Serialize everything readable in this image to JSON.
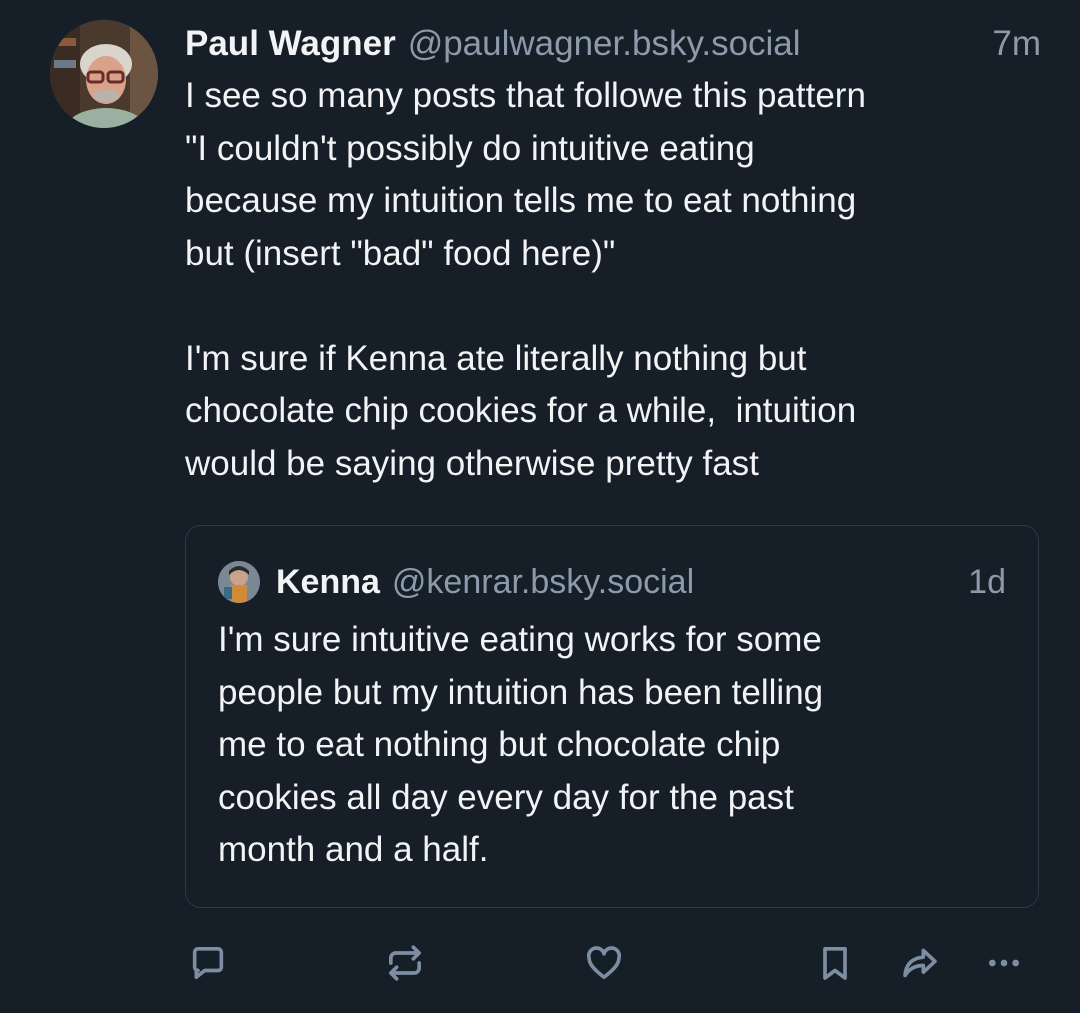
{
  "post": {
    "author": {
      "name": "Paul Wagner",
      "handle": "@paulwagner.bsky.social",
      "avatar_icon": "user-avatar-photo"
    },
    "timestamp": "7m",
    "text": "I see so many posts that followe this pattern\n\"I couldn't possibly do intuitive eating\nbecause my intuition tells me to eat nothing\nbut (insert \"bad\" food here)\"\n\nI'm sure if Kenna ate literally nothing but\nchocolate chip cookies for a while,  intuition\nwould be saying otherwise pretty fast"
  },
  "quote": {
    "author": {
      "name": "Kenna",
      "handle": "@kenrar.bsky.social",
      "avatar_icon": "user-avatar-photo"
    },
    "timestamp": "1d",
    "text": "I'm sure intuitive eating works for some\npeople but my intuition has been telling\nme to eat nothing but chocolate chip\ncookies all day every day for the past\nmonth and a half."
  },
  "actions": [
    {
      "icon": "reply-icon"
    },
    {
      "icon": "repost-icon"
    },
    {
      "icon": "like-icon"
    },
    {
      "icon": "bookmark-icon"
    },
    {
      "icon": "share-icon"
    },
    {
      "icon": "more-options-icon"
    }
  ],
  "colors": {
    "background": "#161e27",
    "text": "#f1f3f5",
    "muted": "#8c9aab",
    "icon": "#7d8ea3",
    "quote_border": "#2e3a48"
  }
}
